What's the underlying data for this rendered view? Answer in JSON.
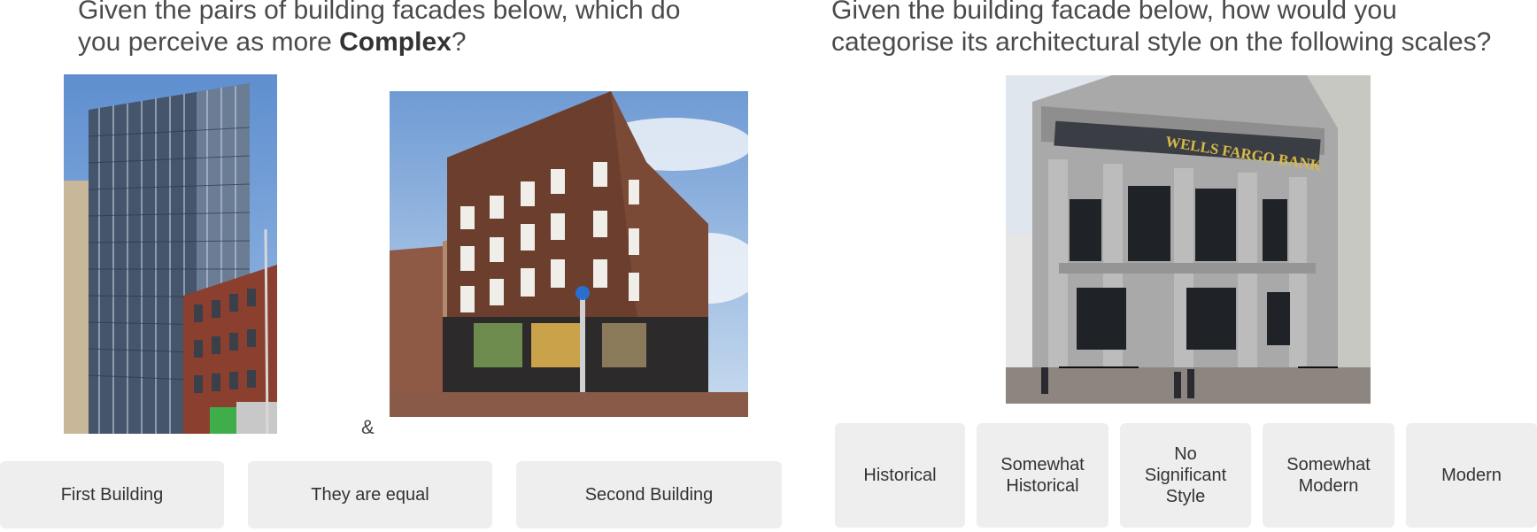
{
  "left_survey": {
    "question": {
      "line1": "Given the pairs of building facades below, which do",
      "line2_prefix": "you perceive as more ",
      "line2_bold": "Complex",
      "line2_suffix": "?"
    },
    "separator": "&",
    "buttons": {
      "first": "First Building",
      "equal": "They are equal",
      "second": "Second Building"
    }
  },
  "right_survey": {
    "question": {
      "line1": "Given the building facade below, how would you",
      "line2": "categorise its architectural style on the following scales?"
    },
    "sign_text": "WELLS FARGO BANK",
    "scale": {
      "historical": "Historical",
      "somewhat_historical": [
        "Somewhat",
        "Historical"
      ],
      "no_significant": [
        "No",
        "Significant",
        "Style"
      ],
      "somewhat_modern": [
        "Somewhat",
        "Modern"
      ],
      "modern": "Modern"
    }
  },
  "colors": {
    "button_bg": "#eeeeee",
    "sky": "#7ea6d8",
    "brick": "#7a4a38",
    "stone": "#9a9a9a"
  }
}
